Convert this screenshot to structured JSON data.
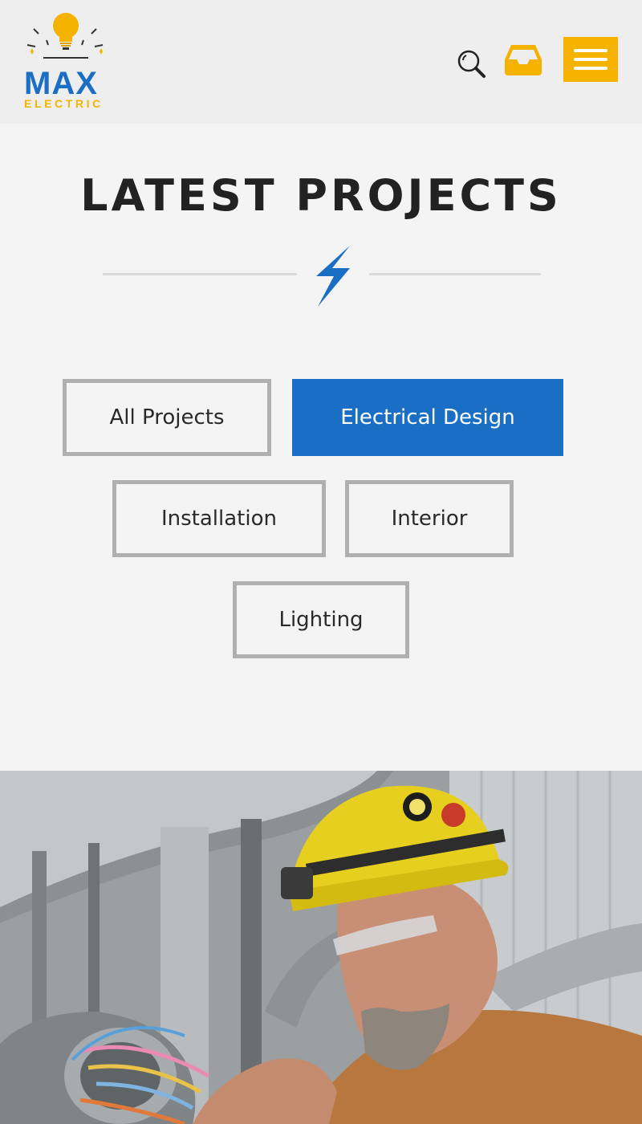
{
  "header": {
    "logo": {
      "name": "MAX",
      "tagline": "ELECTRIC"
    },
    "search_icon": "search-icon",
    "cart_icon": "inbox-tray-icon",
    "menu_icon": "hamburger-menu-icon"
  },
  "section": {
    "title": "LATEST PROJECTS",
    "divider_icon": "lightning-bolt-icon"
  },
  "filters": [
    {
      "label": "All Projects",
      "active": false
    },
    {
      "label": "Electrical Design",
      "active": true
    },
    {
      "label": "Installation",
      "active": false
    },
    {
      "label": "Interior",
      "active": false
    },
    {
      "label": "Lighting",
      "active": false
    }
  ],
  "colors": {
    "brand_blue": "#1a6fc5",
    "brand_yellow": "#f5b300",
    "header_bg": "#eeeeee",
    "page_bg": "#f4f4f4",
    "button_border": "#b0b0b0"
  }
}
